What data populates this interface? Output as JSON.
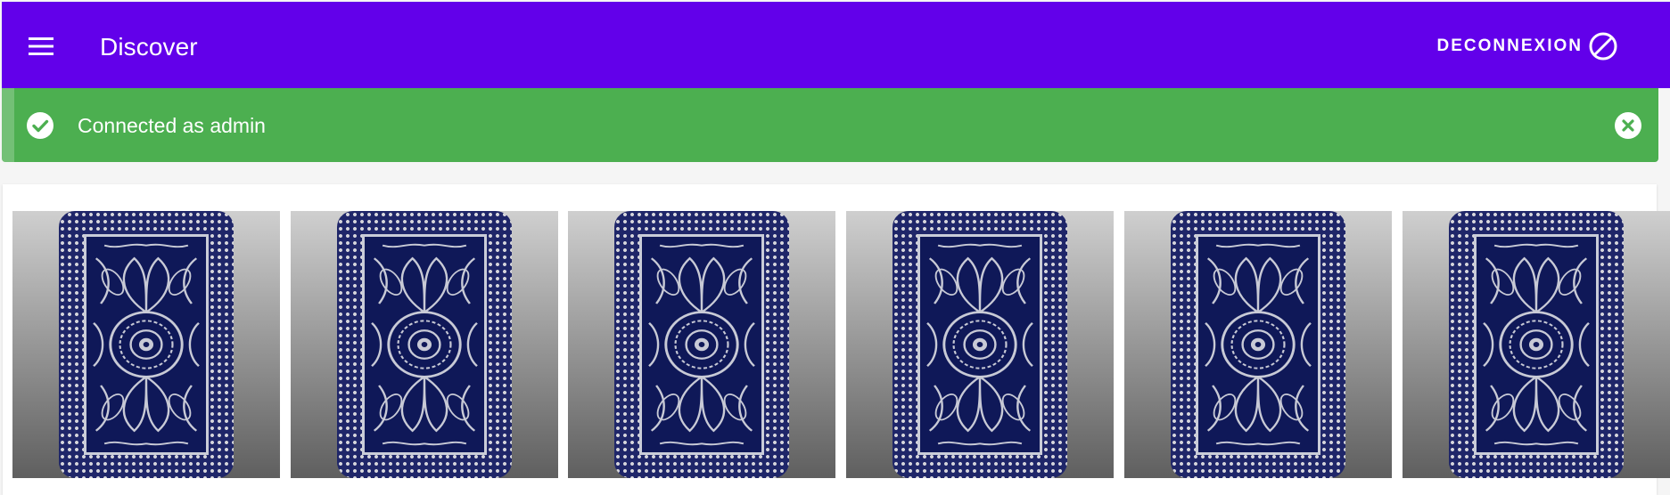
{
  "header": {
    "title": "Discover",
    "menu_icon": "menu-icon",
    "logout_label": "DECONNEXION",
    "logout_icon": "block-icon",
    "color": "#6200ea"
  },
  "alert": {
    "message": "Connected as admin",
    "status_icon": "check-circle-icon",
    "close_icon": "close-circle-icon",
    "color": "#4caf50"
  },
  "cards": [
    {
      "face": "card-back"
    },
    {
      "face": "card-back"
    },
    {
      "face": "card-back"
    },
    {
      "face": "card-back"
    },
    {
      "face": "card-back"
    },
    {
      "face": "card-back"
    }
  ]
}
